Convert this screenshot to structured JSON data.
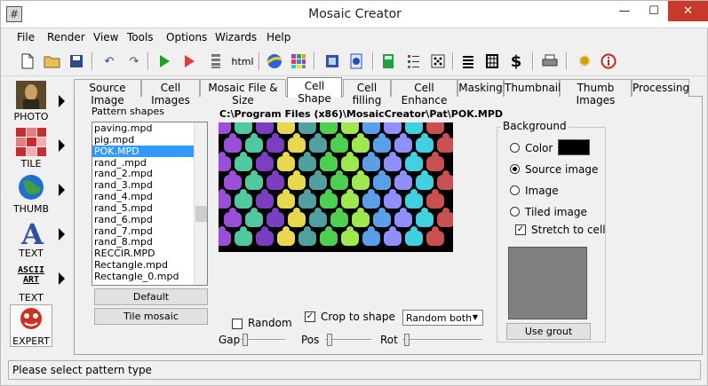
{
  "window": {
    "title": "Mosaic Creator",
    "minimize": "—",
    "maximize": "☐",
    "close": "✕"
  },
  "menu": [
    "File",
    "Render",
    "View",
    "Tools",
    "Options",
    "Wizards",
    "Help"
  ],
  "toolbar": {
    "html_label": "html"
  },
  "left_buttons": [
    {
      "label": "PHOTO",
      "icon": "photo-icon"
    },
    {
      "label": "TILE",
      "icon": "tile-icon"
    },
    {
      "label": "THUMB",
      "icon": "globe-icon"
    },
    {
      "label": "TEXT",
      "icon": "text-a-icon"
    },
    {
      "label": "TEXT",
      "icon": "ascii-art-icon",
      "icon_text": "ASCII ART"
    },
    {
      "label": "EXPERT",
      "icon": "expert-icon"
    }
  ],
  "tabs": [
    "Source Image",
    "Cell Images",
    "Mosaic File & Size",
    "Cell Shape",
    "Cell filling",
    "Cell Enhance",
    "Masking",
    "Thumbnail",
    "Thumb Images",
    "Processing"
  ],
  "active_tab": "Cell Shape",
  "pattern": {
    "label": "Pattern shapes",
    "items": [
      "paving.mpd",
      "pig.mpd",
      "POK.MPD",
      "rand_.mpd",
      "rand_2.mpd",
      "rand_3.mpd",
      "rand_4.mpd",
      "rand_5.mpd",
      "rand_6.mpd",
      "rand_7.mpd",
      "rand_8.mpd",
      "RECCIR.MPD",
      "Rectangle.mpd",
      "Rectangle_0.mpd"
    ],
    "selected": "POK.MPD",
    "default_button": "Default",
    "tile_button": "Tile mosaic"
  },
  "preview": {
    "path": "C:\\Program Files (x86)\\MosaicCreator\\Pat\\POK.MPD",
    "colors": [
      "#9a4fd6",
      "#5aa0e8",
      "#ff6fb0",
      "#4fcf4f",
      "#3a78c8",
      "#e8d84f",
      "#c85050",
      "#50c8a0",
      "#8f8fff",
      "#ff9040",
      "#a0e850",
      "#d050d0",
      "#50a0a0",
      "#e0e0e0",
      "#7a3fc0",
      "#40d0e0"
    ]
  },
  "controls": {
    "random_label": "Random",
    "random_checked": false,
    "crop_label": "Crop to shape",
    "crop_checked": true,
    "mode_value": "Random both",
    "gap_label": "Gap",
    "pos_label": "Pos",
    "rot_label": "Rot"
  },
  "background": {
    "title": "Background",
    "options": [
      "Color",
      "Source image",
      "Image",
      "Tiled image"
    ],
    "selected": "Source image",
    "stretch_label": "Stretch to cell",
    "stretch_checked": true,
    "color_swatch": "#000000",
    "preview_color": "#808080",
    "grout_button": "Use grout"
  },
  "status": "Please select pattern type"
}
